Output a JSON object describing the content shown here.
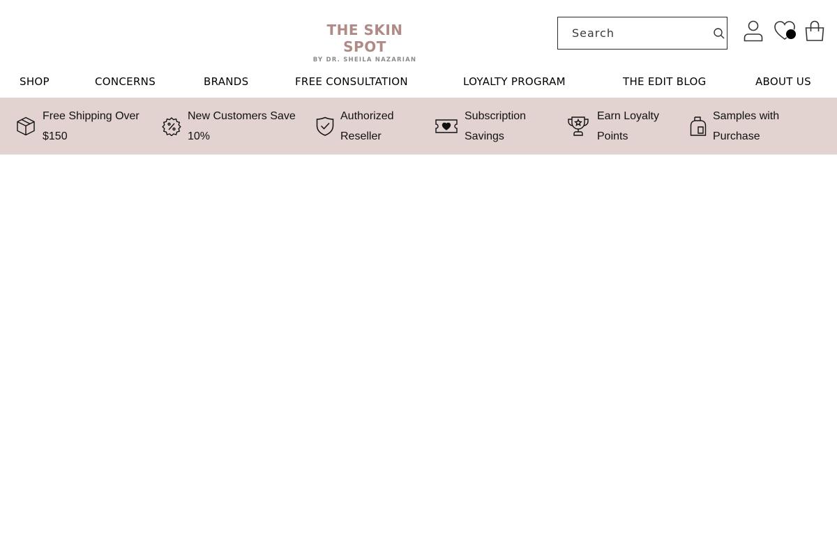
{
  "header": {
    "logo": {
      "title": "THE SKIN SPOT",
      "subtitle": "BY DR. SHEILA NAZARIAN"
    },
    "search": {
      "placeholder": "Search",
      "icon": "search-icon"
    },
    "icons": {
      "account": "user-icon",
      "wishlist": "heart-icon",
      "cart": "shopping-bag-icon"
    }
  },
  "nav": {
    "items": [
      "SHOP",
      "CONCERNS",
      "BRANDS",
      "FREE CONSULTATION",
      "LOYALTY PROGRAM",
      "THE EDIT BLOG",
      "ABOUT US"
    ]
  },
  "features": [
    {
      "line1": "Free Shipping Over",
      "line2": "$150",
      "icon": "box-icon"
    },
    {
      "line1": "New Customers Save",
      "line2": "10%",
      "icon": "discount-badge-icon"
    },
    {
      "line1": "Authorized",
      "line2": "Reseller",
      "icon": "shield-check-icon"
    },
    {
      "line1": "Subscription",
      "line2": "Savings",
      "icon": "ticket-heart-icon"
    },
    {
      "line1": "Earn Loyalty",
      "line2": "Points",
      "icon": "trophy-icon"
    },
    {
      "line1": "Samples with",
      "line2": "Purchase",
      "icon": "sample-bottle-icon"
    }
  ],
  "colors": {
    "brand": "#b08a86",
    "features_bar": "#e2d2d0"
  }
}
